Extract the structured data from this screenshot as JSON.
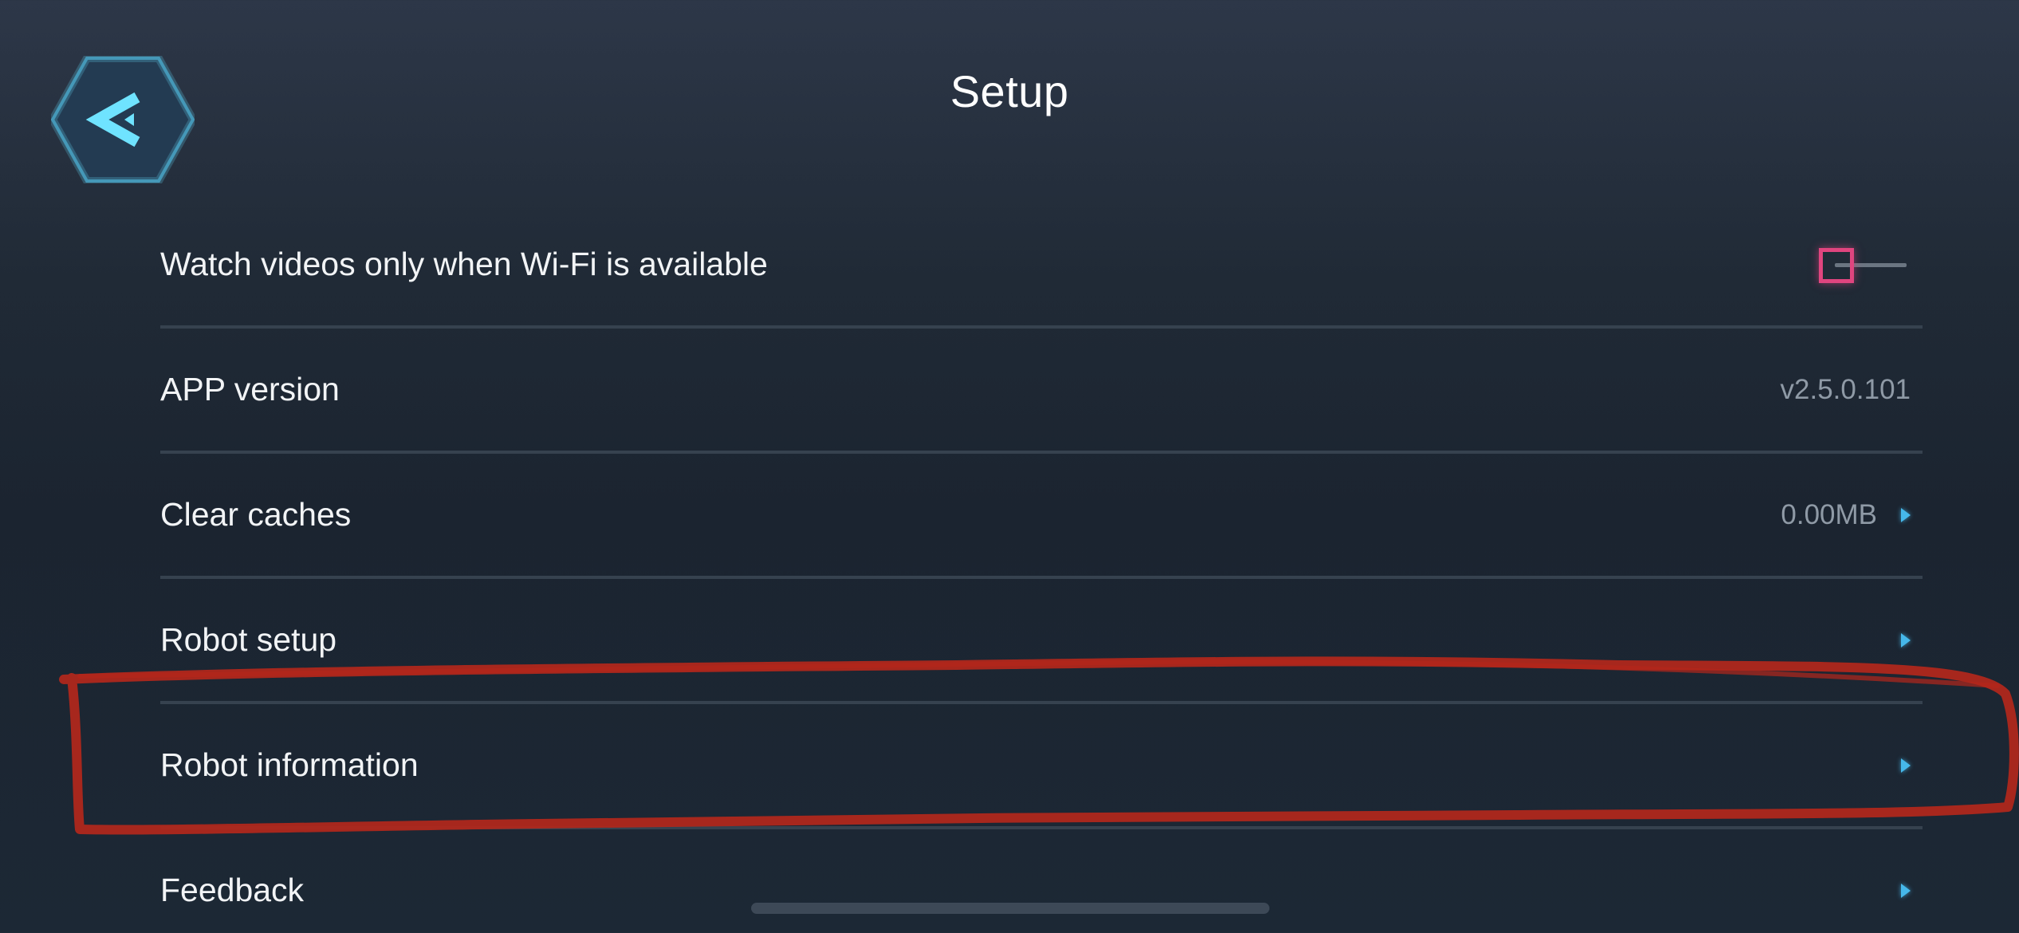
{
  "header": {
    "title": "Setup",
    "back_icon": "chevron-left-hex-icon"
  },
  "settings": {
    "wifi_only": {
      "label": "Watch videos only when Wi-Fi is available",
      "enabled": false
    },
    "app_version": {
      "label": "APP version",
      "value": "v2.5.0.101"
    },
    "clear_caches": {
      "label": "Clear caches",
      "value": "0.00MB"
    },
    "robot_setup": {
      "label": "Robot setup"
    },
    "robot_information": {
      "label": "Robot information"
    },
    "feedback": {
      "label": "Feedback"
    }
  },
  "colors": {
    "accent": "#46b8ea",
    "toggle_off": "#e0457f",
    "annotation": "#b3271b"
  }
}
